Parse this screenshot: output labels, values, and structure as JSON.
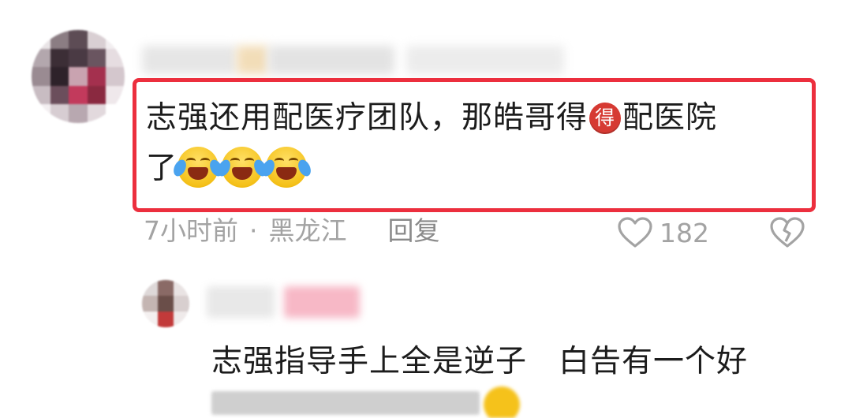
{
  "comment": {
    "text_line1": "志强还用配医疗团队，那皓哥得",
    "badge": "得",
    "text_line1_end": "配医院",
    "text_line2": "了",
    "time": "7小时前",
    "separator": "·",
    "location": "黑龙江",
    "reply_label": "回复",
    "like_count": "182",
    "highlight_color": "#ec2f3e"
  },
  "reply": {
    "text": "志强指导手上全是逆子　白告有一个好"
  }
}
